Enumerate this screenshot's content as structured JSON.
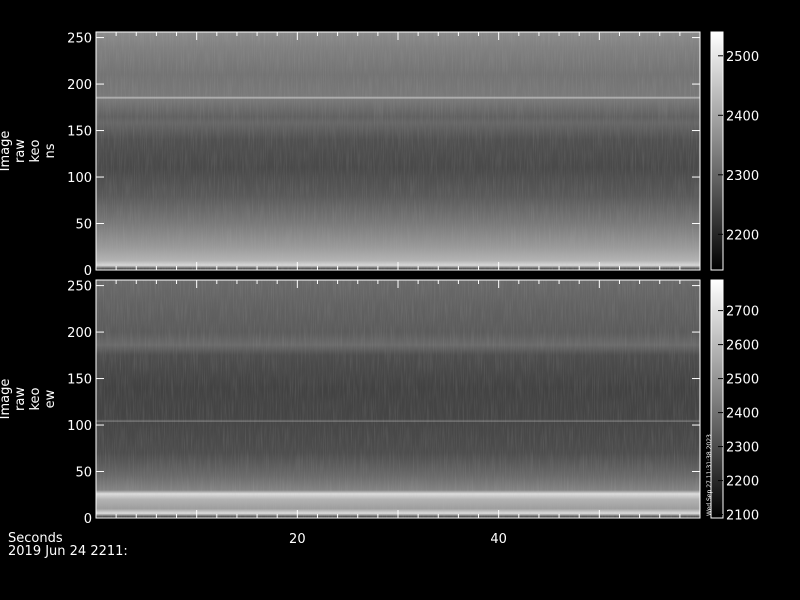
{
  "chart_data": [
    {
      "type": "heatmap",
      "ylabel": [
        "Image",
        "raw",
        "keo",
        "ns"
      ],
      "xlim": [
        0,
        60
      ],
      "ylim": [
        0,
        256
      ],
      "yticks": [
        0,
        50,
        100,
        150,
        200,
        250
      ],
      "colorbar": {
        "range": [
          2140,
          2540
        ],
        "ticks": [
          2200,
          2300,
          2400,
          2500
        ]
      },
      "colormap": "grayscale",
      "profile": [
        {
          "y": 0,
          "v": 2180
        },
        {
          "y": 5,
          "v": 2480
        },
        {
          "y": 10,
          "v": 2420
        },
        {
          "y": 25,
          "v": 2380
        },
        {
          "y": 50,
          "v": 2330
        },
        {
          "y": 80,
          "v": 2280
        },
        {
          "y": 110,
          "v": 2255
        },
        {
          "y": 140,
          "v": 2265
        },
        {
          "y": 158,
          "v": 2300
        },
        {
          "y": 165,
          "v": 2290
        },
        {
          "y": 184,
          "v": 2330
        },
        {
          "y": 185,
          "v": 2440
        },
        {
          "y": 187,
          "v": 2330
        },
        {
          "y": 210,
          "v": 2320
        },
        {
          "y": 240,
          "v": 2340
        },
        {
          "y": 256,
          "v": 2360
        }
      ]
    },
    {
      "type": "heatmap",
      "ylabel": [
        "Image",
        "raw",
        "keo",
        "ew"
      ],
      "xlim": [
        0,
        60
      ],
      "ylim": [
        0,
        256
      ],
      "yticks": [
        0,
        50,
        100,
        150,
        200,
        250
      ],
      "colorbar": {
        "range": [
          2090,
          2790
        ],
        "ticks": [
          2100,
          2200,
          2300,
          2400,
          2500,
          2600,
          2700
        ]
      },
      "colormap": "grayscale",
      "annotation": "Wed Sep 27 11:31:38 2023",
      "profile": [
        {
          "y": 0,
          "v": 2150
        },
        {
          "y": 5,
          "v": 2700
        },
        {
          "y": 10,
          "v": 2520
        },
        {
          "y": 20,
          "v": 2580
        },
        {
          "y": 26,
          "v": 2700
        },
        {
          "y": 30,
          "v": 2450
        },
        {
          "y": 45,
          "v": 2380
        },
        {
          "y": 70,
          "v": 2300
        },
        {
          "y": 103,
          "v": 2280
        },
        {
          "y": 104,
          "v": 2420
        },
        {
          "y": 106,
          "v": 2280
        },
        {
          "y": 140,
          "v": 2270
        },
        {
          "y": 175,
          "v": 2300
        },
        {
          "y": 186,
          "v": 2380
        },
        {
          "y": 200,
          "v": 2340
        },
        {
          "y": 230,
          "v": 2360
        },
        {
          "y": 256,
          "v": 2380
        }
      ]
    }
  ],
  "xaxis": {
    "ticks": [
      20,
      40
    ],
    "label": "Seconds",
    "sublabel": "2019 Jun 24 2211:"
  }
}
